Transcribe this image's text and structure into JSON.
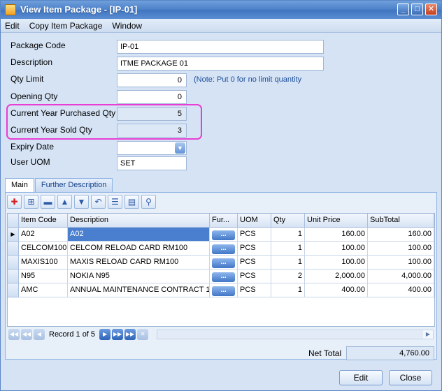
{
  "window": {
    "title": "View Item Package - [IP-01]",
    "buttons": [
      "_",
      "□",
      "✕"
    ]
  },
  "menu": [
    "Edit",
    "Copy Item Package",
    "Window"
  ],
  "form": {
    "package_code_label": "Package Code",
    "package_code": "IP-01",
    "description_label": "Description",
    "description": "ITME PACKAGE 01",
    "qty_limit_label": "Qty Limit",
    "qty_limit": "0",
    "qty_limit_note": "(Note: Put 0 for no limit quantity",
    "opening_qty_label": "Opening Qty",
    "opening_qty": "0",
    "purchased_label": "Current Year Purchased Qty",
    "purchased": "5",
    "sold_label": "Current Year Sold Qty",
    "sold": "3",
    "expiry_label": "Expiry Date",
    "expiry": "",
    "uom_label": "User UOM",
    "uom": "SET"
  },
  "tabs": [
    "Main",
    "Further Description"
  ],
  "grid": {
    "headers": [
      "Item Code",
      "Description",
      "Fur...",
      "UOM",
      "Qty",
      "Unit Price",
      "SubTotal"
    ],
    "rows": [
      {
        "code": "A02",
        "desc": "A02",
        "uom": "PCS",
        "qty": "1",
        "price": "160.00",
        "sub": "160.00"
      },
      {
        "code": "CELCOM100",
        "desc": "CELCOM RELOAD CARD RM100",
        "uom": "PCS",
        "qty": "1",
        "price": "100.00",
        "sub": "100.00"
      },
      {
        "code": "MAXIS100",
        "desc": "MAXIS RELOAD CARD RM100",
        "uom": "PCS",
        "qty": "1",
        "price": "100.00",
        "sub": "100.00"
      },
      {
        "code": "N95",
        "desc": "NOKIA N95",
        "uom": "PCS",
        "qty": "2",
        "price": "2,000.00",
        "sub": "4,000.00"
      },
      {
        "code": "AMC",
        "desc": "ANNUAL MAINTENANCE CONTRACT 1",
        "uom": "PCS",
        "qty": "1",
        "price": "400.00",
        "sub": "400.00"
      }
    ],
    "ellipsis": "...",
    "record_text": "Record 1 of 5"
  },
  "footer": {
    "net_total_label": "Net Total",
    "net_total": "4,760.00",
    "edit_label": "Edit",
    "close_label": "Close"
  }
}
